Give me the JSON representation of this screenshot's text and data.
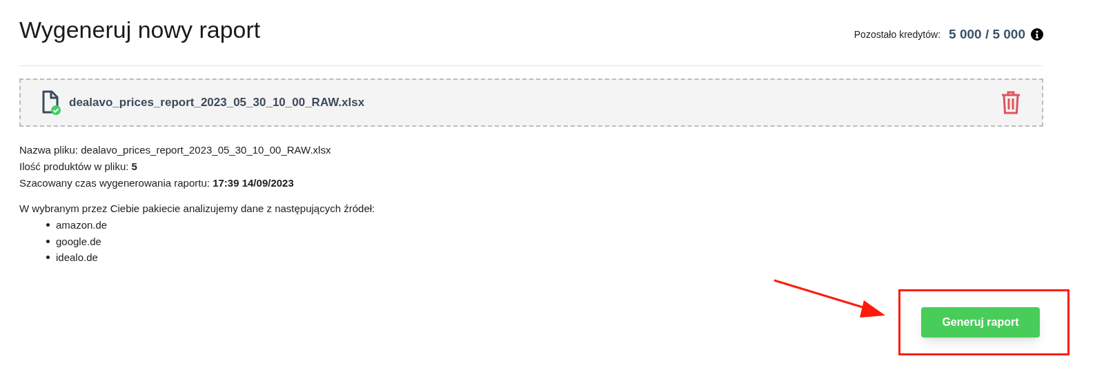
{
  "title": "Wygeneruj nowy raport",
  "credits": {
    "label": "Pozostało kredytów:",
    "value": "5 000 / 5 000"
  },
  "file": {
    "name": "dealavo_prices_report_2023_05_30_10_00_RAW.xlsx",
    "verified": true
  },
  "details": [
    "Nazwa pliku: dealavo_prices_report_2023_05_30_10_00_RAW.xlsx",
    "Ilość produktów w pliku: **5**",
    "Szacowany czas wygenerowania raportu: **17:39 14/09/2023**"
  ],
  "sources_intro": "W wybranym przez Ciebie pakiecie analizujemy dane z następujących źródeł:",
  "sources": [
    "amazon.de",
    "google.de",
    "idealo.de"
  ],
  "button": {
    "label": "Generuj raport"
  },
  "annotation": {
    "highlighted": true
  }
}
